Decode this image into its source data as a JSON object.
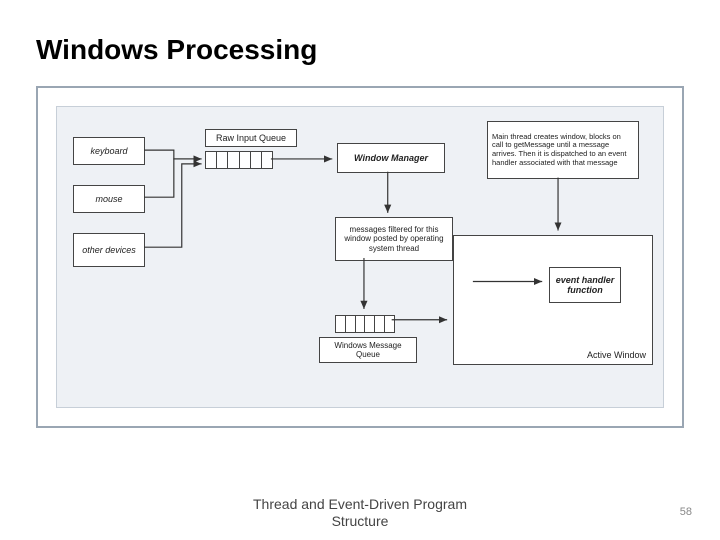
{
  "title": "Windows Processing",
  "footer_line1": "Thread and Event-Driven Program",
  "footer_line2": "Structure",
  "page_number": "58",
  "boxes": {
    "keyboard": "keyboard",
    "mouse": "mouse",
    "other": "other devices",
    "riq_label": "Raw Input Queue",
    "winmgr": "Window Manager",
    "annot": "Main thread creates window, blocks on call to getMessage until a message arrives. Then it is dispatched to an event handler associated with that message",
    "filter": "messages filtered for this window posted by operating system thread",
    "wmq_label": "Windows Message Queue",
    "active_window": "Active Window",
    "evh": "event handler function"
  },
  "chart_data": {
    "type": "flow-diagram",
    "title": "Windows Processing",
    "nodes": [
      {
        "id": "keyboard",
        "label": "keyboard",
        "kind": "source"
      },
      {
        "id": "mouse",
        "label": "mouse",
        "kind": "source"
      },
      {
        "id": "other",
        "label": "other devices",
        "kind": "source"
      },
      {
        "id": "raw_input_queue",
        "label": "Raw Input Queue",
        "kind": "queue"
      },
      {
        "id": "window_manager",
        "label": "Window Manager",
        "kind": "process"
      },
      {
        "id": "filter",
        "label": "messages filtered for this window posted by operating system thread",
        "kind": "process"
      },
      {
        "id": "windows_message_queue",
        "label": "Windows Message Queue",
        "kind": "queue"
      },
      {
        "id": "active_window",
        "label": "Active Window",
        "kind": "container"
      },
      {
        "id": "event_handler",
        "label": "event handler function",
        "kind": "process",
        "parent": "active_window"
      },
      {
        "id": "annotation",
        "label": "Main thread creates window, blocks on call to getMessage until a message arrives. Then it is dispatched to an event handler associated with that message",
        "kind": "note"
      }
    ],
    "edges": [
      {
        "from": "keyboard",
        "to": "raw_input_queue"
      },
      {
        "from": "mouse",
        "to": "raw_input_queue"
      },
      {
        "from": "other",
        "to": "raw_input_queue"
      },
      {
        "from": "raw_input_queue",
        "to": "window_manager"
      },
      {
        "from": "window_manager",
        "to": "filter"
      },
      {
        "from": "filter",
        "to": "windows_message_queue"
      },
      {
        "from": "windows_message_queue",
        "to": "active_window"
      },
      {
        "from": "active_window",
        "to": "event_handler"
      },
      {
        "from": "annotation",
        "to": "active_window"
      }
    ]
  }
}
